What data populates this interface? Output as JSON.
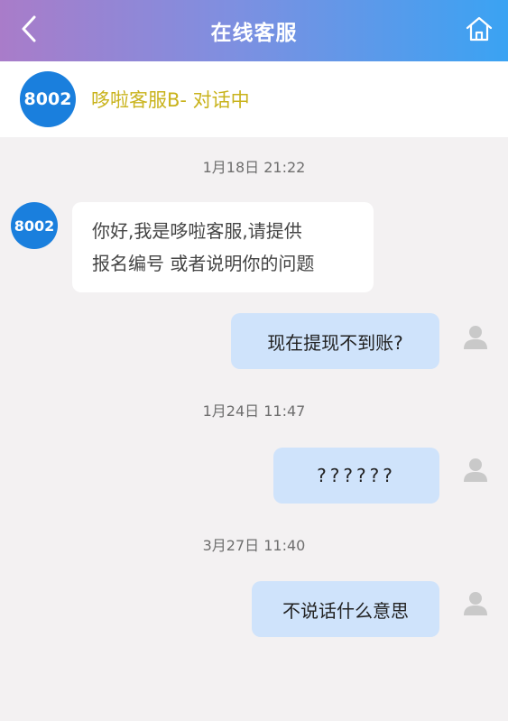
{
  "header": {
    "title": "在线客服",
    "back_icon": "chevron-left-icon",
    "home_icon": "home-icon"
  },
  "agent": {
    "avatar_label": "8002",
    "status_text": "哆啦客服B- 对话中"
  },
  "messages": [
    {
      "type": "timestamp",
      "text": "1月18日 21:22"
    },
    {
      "type": "agent",
      "avatar": "8002",
      "lines": [
        "你好,我是哆啦客服,请提供",
        "报名编号 或者说明你的问题"
      ]
    },
    {
      "type": "user",
      "text": "现在提现不到账?"
    },
    {
      "type": "timestamp",
      "text": "1月24日 11:47"
    },
    {
      "type": "user",
      "text": "??????"
    },
    {
      "type": "timestamp",
      "text": "3月27日 11:40"
    },
    {
      "type": "user",
      "text": "不说话什么意思"
    }
  ],
  "colors": {
    "header_gradient_start": "#a97cc9",
    "header_gradient_end": "#3aa3f3",
    "agent_avatar": "#1a7fdd",
    "status_text": "#c9b31c",
    "user_bubble": "#cfe3fb"
  }
}
